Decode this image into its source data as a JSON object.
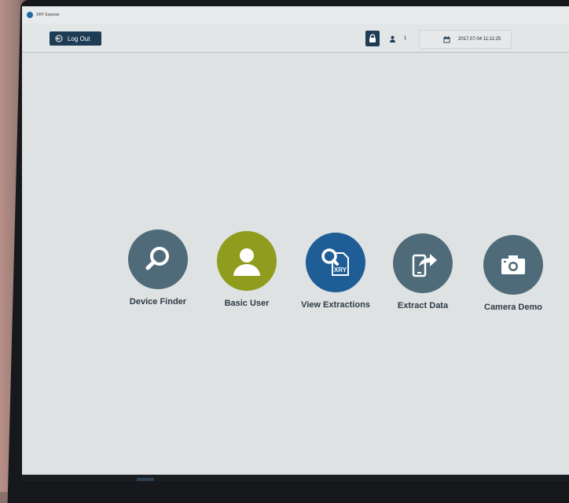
{
  "window": {
    "title": "XRY Express"
  },
  "toolbar": {
    "logout_label": "Log Out",
    "user_count": "1",
    "datetime": "2017.07.04 11:11:25"
  },
  "tiles": [
    {
      "label": "Device Finder",
      "color": "#4f6b7a",
      "icon": "magnifier-icon"
    },
    {
      "label": "Basic User",
      "color": "#8f9c1d",
      "icon": "user-icon"
    },
    {
      "label": "View Extractions",
      "color": "#1e5d95",
      "icon": "xry-file-search-icon"
    },
    {
      "label": "Extract Data",
      "color": "#4f6b7a",
      "icon": "phone-share-icon"
    },
    {
      "label": "Camera Demo",
      "color": "#4f6b7a",
      "icon": "camera-icon"
    }
  ],
  "colors": {
    "toolbar_button": "#1f3c55",
    "screen_bg": "#dfe2e3",
    "accent_blue": "#1e5d95"
  }
}
